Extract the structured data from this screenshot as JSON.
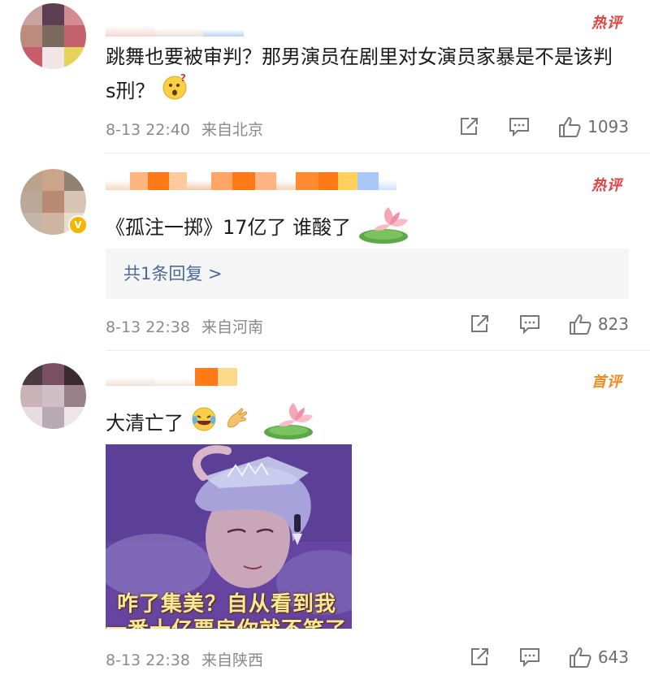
{
  "comments": [
    {
      "tag": "热评",
      "text": "跳舞也要被审判？那男演员在剧里对女演员家暴是不是该判s刑？",
      "emoji": "thinking-face-emoji",
      "time": "8-13 22:40",
      "location": "来自北京",
      "likes": "1093"
    },
    {
      "tag": "热评",
      "text": "《孤注一掷》17亿了 谁酸了",
      "sticker": "lotus-sticker",
      "reply_link": "共1条回复 >",
      "time": "8-13 22:38",
      "location": "来自河南",
      "likes": "823"
    },
    {
      "tag": "首评",
      "text": "大清亡了",
      "emojis": [
        "laughing-tears-emoji",
        "ok-hand-emoji"
      ],
      "sticker": "lotus-sticker",
      "image_caption_line1": "咋了集美？自从看到我",
      "image_caption_line2": "一番十亿票房你就不笑了",
      "time": "8-13 22:38",
      "location": "来自陕西",
      "likes": "643"
    }
  ],
  "colors": {
    "hot_tag": "#e0433f",
    "first_tag": "#f08a1c",
    "reply_link": "#4b6a97",
    "meta": "#8a8a8a"
  },
  "icons": [
    "share-icon",
    "comment-icon",
    "like-icon"
  ]
}
